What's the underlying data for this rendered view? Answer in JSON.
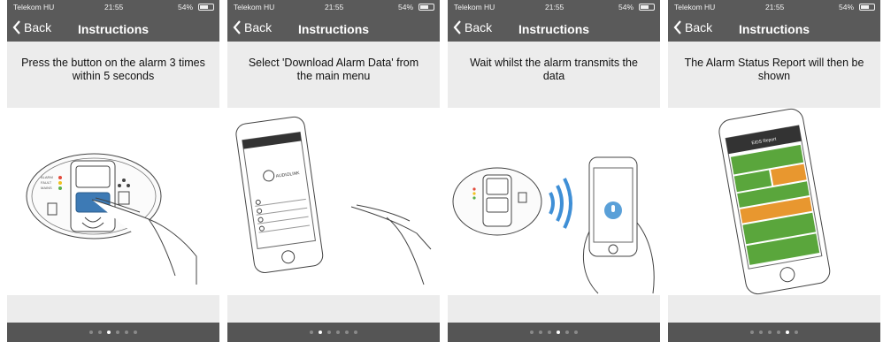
{
  "status_bar": {
    "carrier": "Telekom HU",
    "time": "21:55",
    "battery": "54%"
  },
  "nav": {
    "back_label": "Back",
    "title": "Instructions"
  },
  "steps": [
    {
      "instruction": "Press the button on the alarm 3 times within 5 seconds",
      "active_page": 3
    },
    {
      "instruction": "Select 'Download Alarm Data' from the main menu",
      "active_page": 2
    },
    {
      "instruction": "Wait whilst the alarm transmits the data",
      "active_page": 4
    },
    {
      "instruction": "The Alarm Status Report will then be shown",
      "active_page": 5
    }
  ],
  "page_dots_total": 6,
  "illustration_text": {
    "alarm_labels": [
      "ALARM",
      "FAULT",
      "MAINS"
    ],
    "phone_brand": "AUDIOLINK",
    "report_title": "EIDS Report"
  },
  "colors": {
    "bar": "#5a5a5a",
    "footer": "#555555",
    "report_green": "#5aa63c",
    "report_orange": "#e8972f",
    "wave_blue": "#3f8fd6"
  }
}
